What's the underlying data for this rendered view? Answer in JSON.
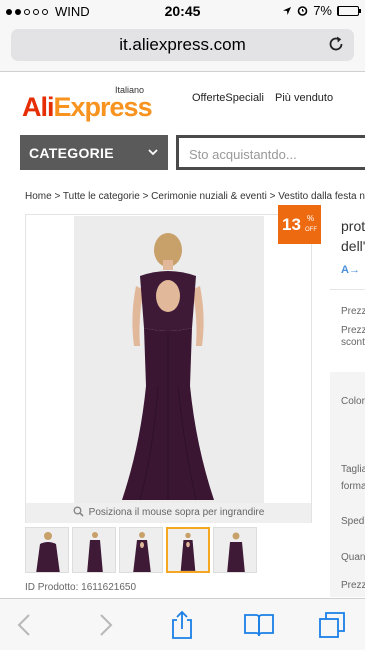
{
  "status_bar": {
    "carrier": "WIND",
    "time": "20:45",
    "battery": "7%",
    "battery_level": 0.07
  },
  "browser": {
    "url": "it.aliexpress.com"
  },
  "header": {
    "logo_part1": "Ali",
    "logo_part2": "Express",
    "language": "Italiano",
    "links": [
      "OfferteSpeciali",
      "Più venduto"
    ],
    "categories_label": "CATEGORIE",
    "search_placeholder": "Sto acquistantdo..."
  },
  "breadcrumb": "Home > Tutte le categorie > Cerimonie nuziali & eventi > Vestito dalla festa nuziale",
  "product": {
    "discount_value": "13",
    "discount_percent": "%",
    "discount_off": "OFF",
    "zoom_hint": "Posiziona il mouse sopra per ingrandire",
    "product_id": "ID Prodotto: 1611621650",
    "thumbnail_count": 5,
    "active_thumbnail": 4
  },
  "details": {
    "title_line1": "prot",
    "title_line2": "dell'",
    "translate_icon": "A→",
    "labels": [
      "Prezz",
      "Prezz",
      "scont",
      "Color",
      "Taglia",
      "forma",
      "Spedi",
      "Quan",
      "Prezz"
    ]
  },
  "colors": {
    "accent_red": "#e62e04",
    "accent_orange": "#f7931e",
    "badge": "#ee6a10",
    "dress": "#3e1a36",
    "ios_blue": "#1a7fe6"
  }
}
